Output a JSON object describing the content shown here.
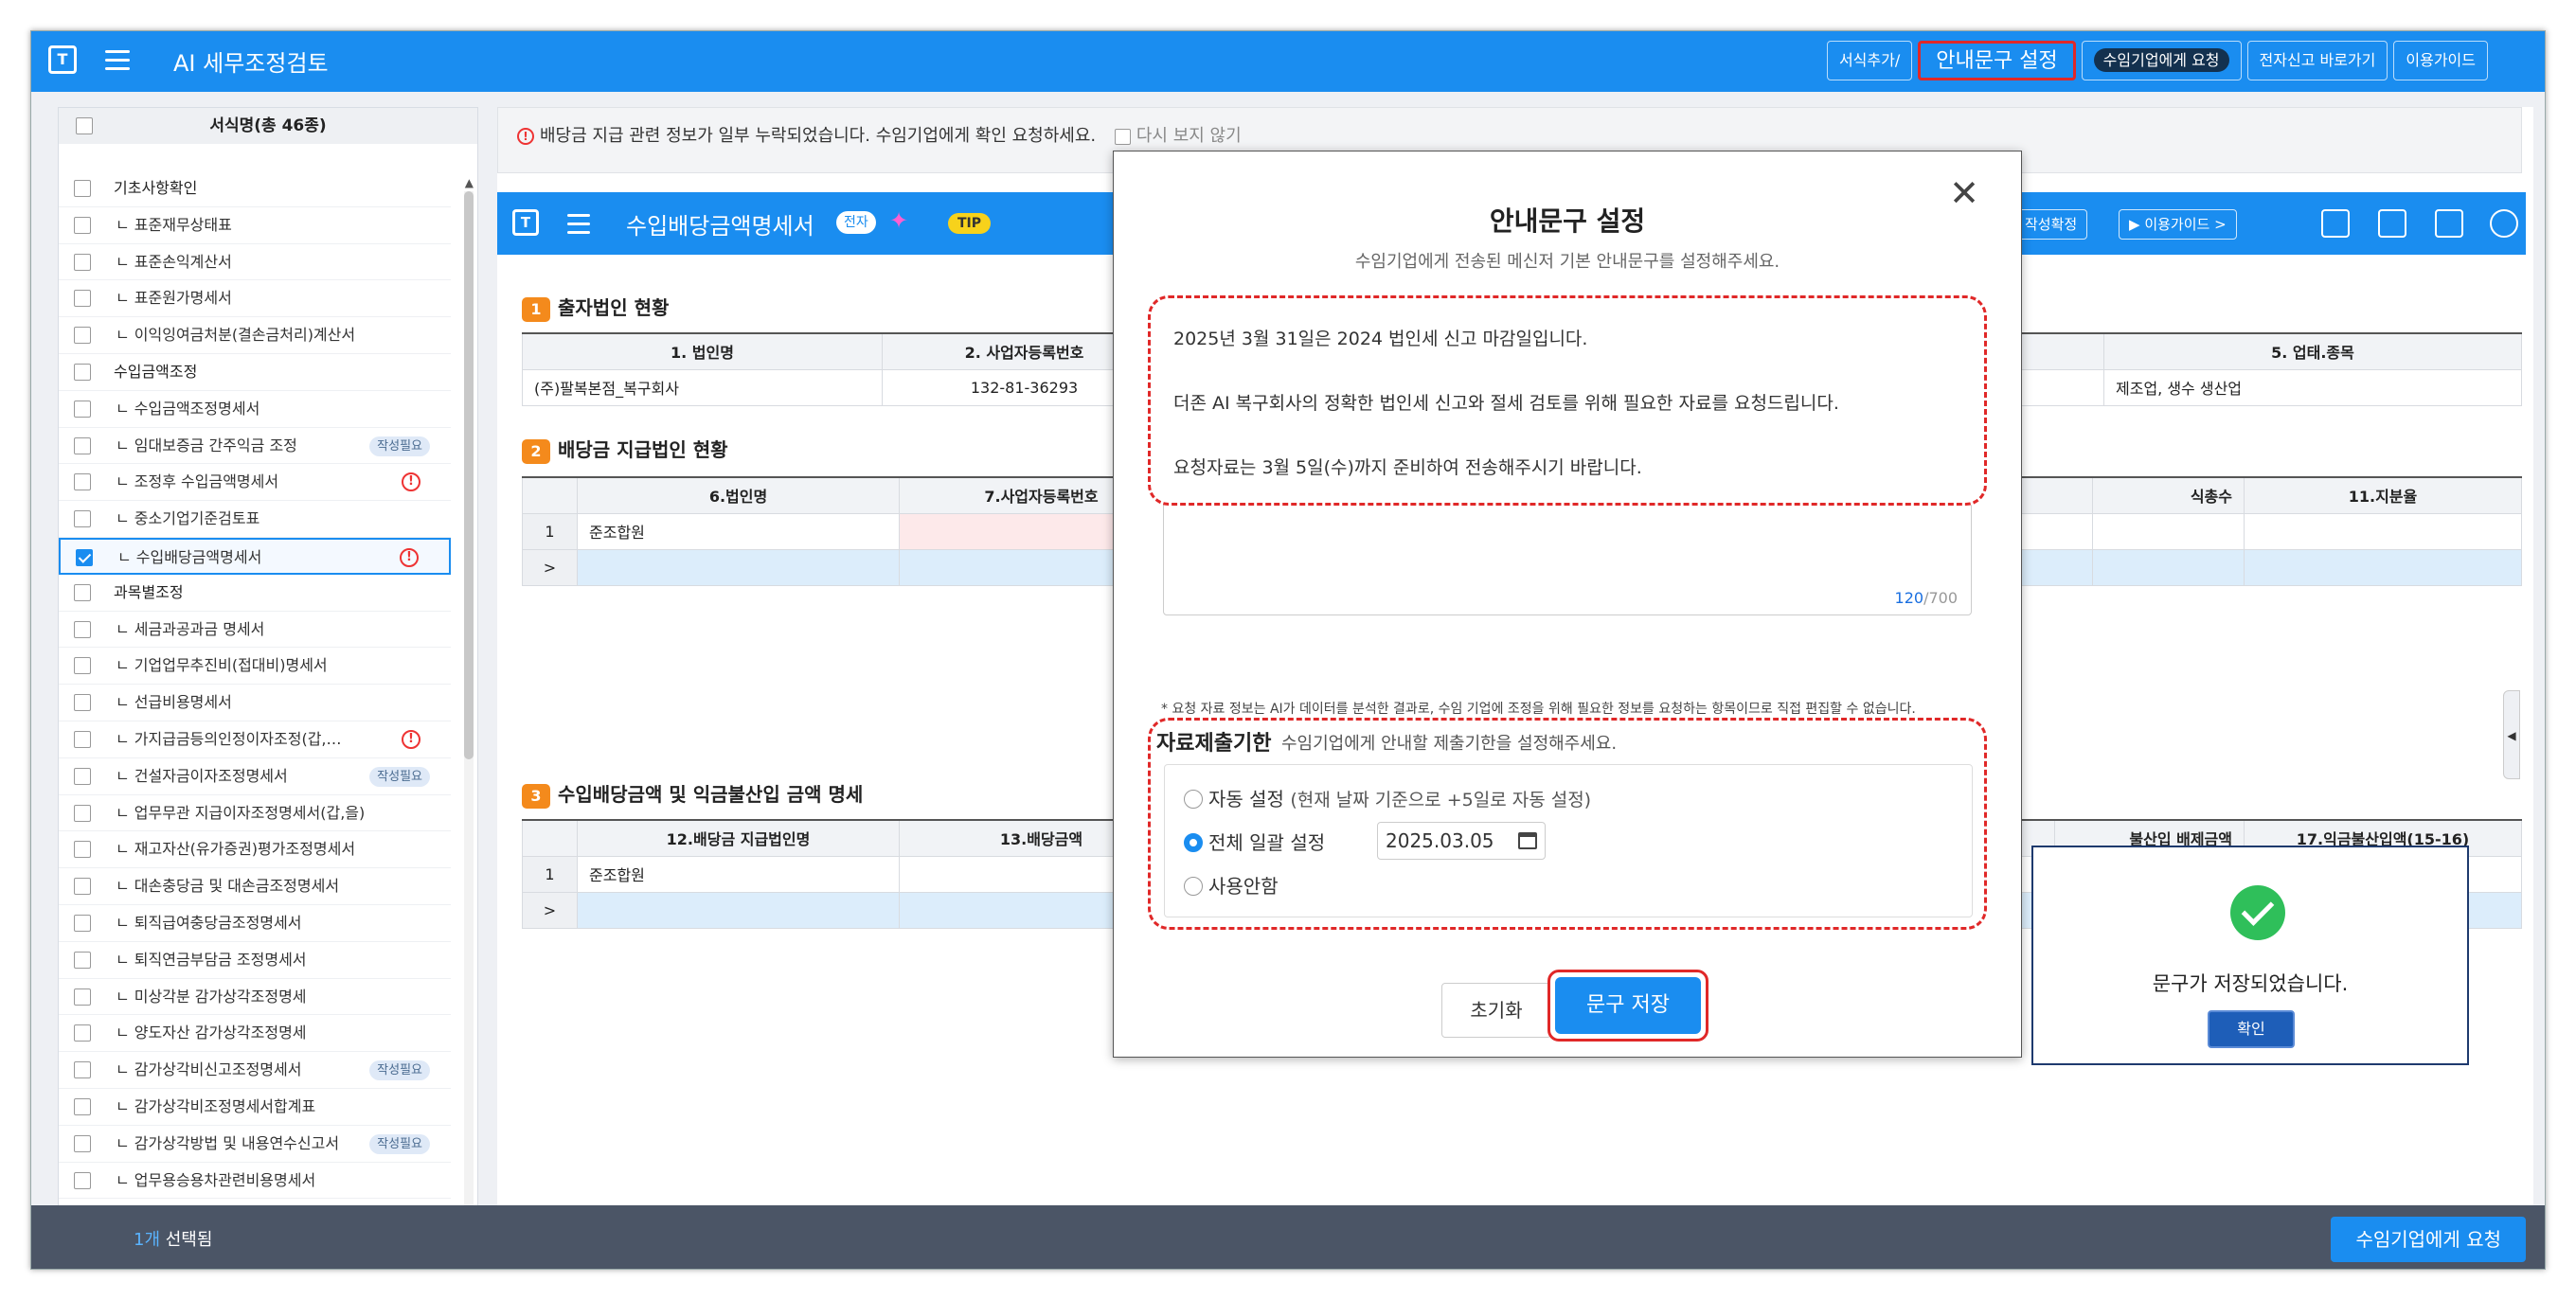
{
  "topbar": {
    "title": "AI 세무조정검토",
    "buttons": [
      "서식추가/",
      "안내문구 설정",
      "수임기업에게 요청",
      "전자신고 바로가기",
      "이용가이드"
    ]
  },
  "sidebar": {
    "header": "서식명(총 46종)",
    "items": [
      {
        "label": "기초사항확인",
        "type": "group"
      },
      {
        "label": "ㄴ 표준재무상태표",
        "type": "sub"
      },
      {
        "label": "ㄴ 표준손익계산서",
        "type": "sub"
      },
      {
        "label": "ㄴ 표준원가명세서",
        "type": "sub"
      },
      {
        "label": "ㄴ 이익잉여금처분(결손금처리)계산서",
        "type": "sub"
      },
      {
        "label": "수입금액조정",
        "type": "group"
      },
      {
        "label": "ㄴ 수입금액조정명세서",
        "type": "sub"
      },
      {
        "label": "ㄴ 임대보증금 간주익금 조정",
        "type": "sub",
        "badge": "작성필요"
      },
      {
        "label": "ㄴ 조정후 수입금액명세서",
        "type": "sub",
        "warn": "!"
      },
      {
        "label": "ㄴ 중소기업기준검토표",
        "type": "sub"
      },
      {
        "label": "ㄴ 수입배당금액명세서",
        "type": "sub",
        "warn": "!",
        "selected": true
      },
      {
        "label": "과목별조정",
        "type": "group"
      },
      {
        "label": "ㄴ 세금과공과금 명세서",
        "type": "sub"
      },
      {
        "label": "ㄴ 기업업무추진비(접대비)명세서",
        "type": "sub"
      },
      {
        "label": "ㄴ 선급비용명세서",
        "type": "sub"
      },
      {
        "label": "ㄴ 가지급금등의인정이자조정(갑,…",
        "type": "sub",
        "warn": "!"
      },
      {
        "label": "ㄴ 건설자금이자조정명세서",
        "type": "sub",
        "badge": "작성필요"
      },
      {
        "label": "ㄴ 업무무관 지급이자조정명세서(갑,을)",
        "type": "sub"
      },
      {
        "label": "ㄴ 재고자산(유가증권)평가조정명세서",
        "type": "sub"
      },
      {
        "label": "ㄴ 대손충당금 및 대손금조정명세서",
        "type": "sub"
      },
      {
        "label": "ㄴ 퇴직급여충당금조정명세서",
        "type": "sub"
      },
      {
        "label": "ㄴ 퇴직연금부담금 조정명세서",
        "type": "sub"
      },
      {
        "label": "ㄴ 미상각분 감가상각조정명세",
        "type": "sub"
      },
      {
        "label": "ㄴ 양도자산 감가상각조정명세",
        "type": "sub"
      },
      {
        "label": "ㄴ 감가상각비신고조정명세서",
        "type": "sub",
        "badge": "작성필요"
      },
      {
        "label": "ㄴ 감가상각비조정명세서합계표",
        "type": "sub"
      },
      {
        "label": "ㄴ 감가상각방법 및 내용연수신고서",
        "type": "sub",
        "badge": "작성필요"
      },
      {
        "label": "ㄴ 업무용승용차관련비용명세서",
        "type": "sub"
      }
    ]
  },
  "notice": {
    "text": "배당금 지급 관련 정보가 일부 누락되었습니다. 수임기업에게 확인 요청하세요.",
    "checkbox": "다시 보지 않기"
  },
  "form": {
    "title": "수입배당금액명세서",
    "pill": "전자",
    "tip": "TIP",
    "btn_confirm": "작성확정",
    "btn_guide": "이용가이드 >"
  },
  "section1": {
    "title": "출자법인 현황",
    "headers": [
      "1. 법인명",
      "2. 사업자등록번호",
      "5. 업태.종목"
    ],
    "row": [
      "(주)팔복본점_복구회사",
      "132-81-36293",
      "제조업, 생수 생산업"
    ]
  },
  "section2": {
    "title": "배당금 지급법인 현황",
    "headers": [
      "6.법인명",
      "7.사업자등록번호",
      "식총수",
      "11.지분율"
    ],
    "row_no": "1",
    "row_name": "준조합원",
    "arrow": ">"
  },
  "section3": {
    "title": "수입배당금액 및 익금불산입 금액 명세",
    "headers": [
      "12.배당금 지급법인명",
      "13.배당금액",
      "불산입 배제금액",
      "17.익금불산입액(15-16)"
    ],
    "row_no": "1",
    "row_name": "준조합원",
    "ghost_date": "2025.03.05",
    "arrow": ">"
  },
  "modal": {
    "title": "안내문구 설정",
    "subtitle": "수임기업에게 전송된 메신저 기본 안내문구를 설정해주세요.",
    "message_lines": [
      "2025년 3월 31일은 2024 법인세 신고 마감일입니다.",
      "더존 AI 복구회사의 정확한 법인세 신고와 절세 검토를 위해 필요한 자료를 요청드립니다.",
      "요청자료는 3월 5일(수)까지 준비하여 전송해주시기 바랍니다."
    ],
    "char_count": "120",
    "char_max": "/700",
    "note": "* 요청 자료 정보는 AI가 데이터를 분석한 결과로, 수임 기업에 조정을 위해 필요한 정보를 요청하는 항목이므로 직접 편집할 수 없습니다.",
    "deadline_title": "자료제출기한",
    "deadline_sub": "수임기업에게 안내할 제출기한을 설정해주세요.",
    "opt_auto": "자동 설정",
    "opt_auto_desc": "(현재 날짜 기준으로 +5일로 자동 설정)",
    "opt_all": "전체 일괄 설정",
    "opt_none": "사용안함",
    "date": "2025.03.05",
    "btn_reset": "초기화",
    "btn_save": "문구 저장"
  },
  "toast": {
    "message": "문구가 저장되었습니다.",
    "ok": "확인"
  },
  "footer": {
    "count": "1개",
    "selected_label": "선택됨",
    "request": "수임기업에게 요청"
  },
  "colors": {
    "primary": "#1a8df0",
    "highlight": "#e02828",
    "section_num": "#f48a1c",
    "footer": "#4b5566",
    "success": "#2fbf5a"
  }
}
